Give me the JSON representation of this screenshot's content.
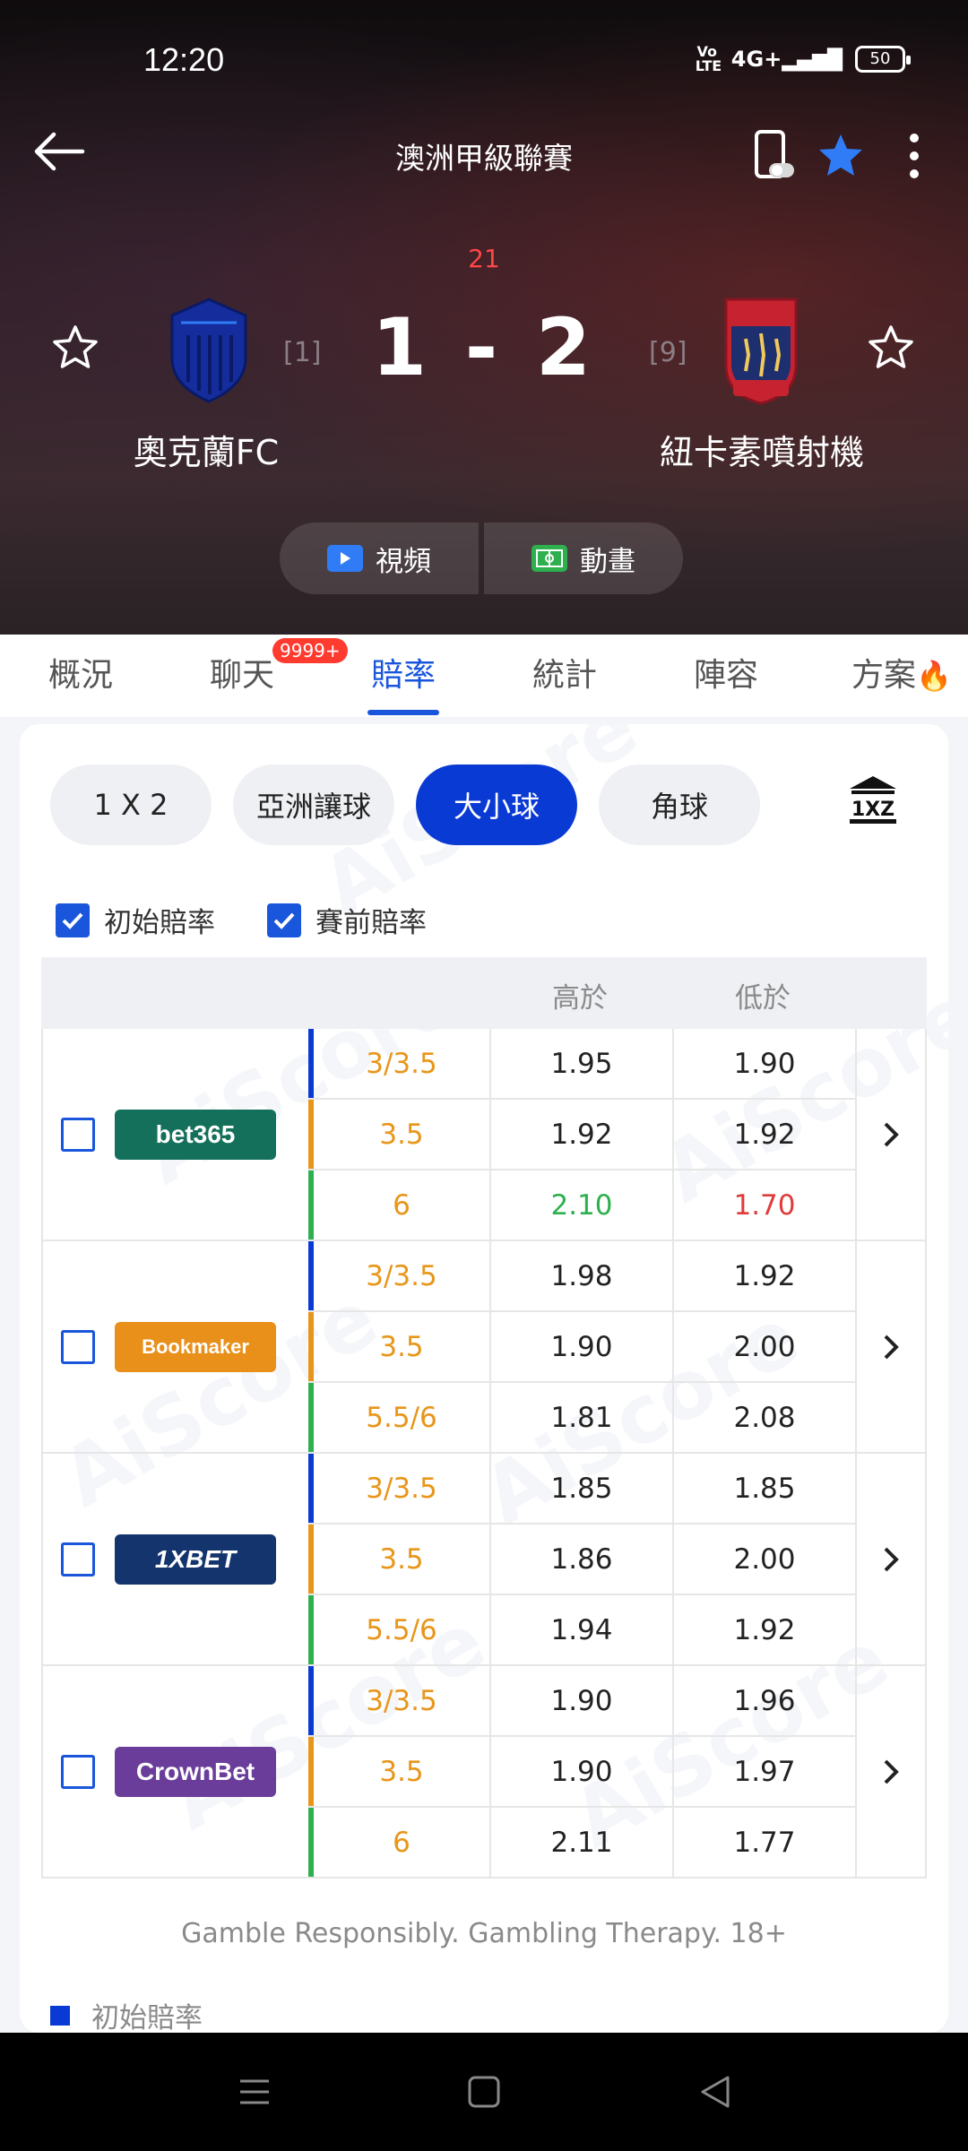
{
  "status": {
    "time": "12:20",
    "volte": "Vo LTE",
    "signal": "4G+",
    "battery": "50"
  },
  "header": {
    "league": "澳洲甲級聯賽",
    "minute": "21",
    "score": "1 - 2",
    "home": {
      "name": "奧克蘭FC",
      "rank": "[1]"
    },
    "away": {
      "name": "紐卡素噴射機",
      "rank": "[9]"
    },
    "video_label": "視頻",
    "animation_label": "動畫"
  },
  "tabs": [
    {
      "label": "概況"
    },
    {
      "label": "聊天",
      "badge": "9999+"
    },
    {
      "label": "賠率"
    },
    {
      "label": "統計"
    },
    {
      "label": "陣容"
    },
    {
      "label": "方案"
    }
  ],
  "filters": [
    "1 X 2",
    "亞洲讓球",
    "大小球",
    "角球"
  ],
  "checks": {
    "opening": "初始賠率",
    "pre_match": "賽前賠率"
  },
  "table": {
    "head_over": "高於",
    "head_under": "低於",
    "books": [
      {
        "name": "bet365",
        "rows": [
          {
            "line": "3/3.5",
            "over": "1.95",
            "under": "1.90"
          },
          {
            "line": "3.5",
            "over": "1.92",
            "under": "1.92"
          },
          {
            "line": "6",
            "over": "2.10",
            "under": "1.70"
          }
        ]
      },
      {
        "name": "Bookmaker",
        "rows": [
          {
            "line": "3/3.5",
            "over": "1.98",
            "under": "1.92"
          },
          {
            "line": "3.5",
            "over": "1.90",
            "under": "2.00"
          },
          {
            "line": "5.5/6",
            "over": "1.81",
            "under": "2.08"
          }
        ]
      },
      {
        "name": "1XBET",
        "rows": [
          {
            "line": "3/3.5",
            "over": "1.85",
            "under": "1.85"
          },
          {
            "line": "3.5",
            "over": "1.86",
            "under": "2.00"
          },
          {
            "line": "5.5/6",
            "over": "1.94",
            "under": "1.92"
          }
        ]
      },
      {
        "name": "CrownBet",
        "rows": [
          {
            "line": "3/3.5",
            "over": "1.90",
            "under": "1.96"
          },
          {
            "line": "3.5",
            "over": "1.90",
            "under": "1.97"
          },
          {
            "line": "6",
            "over": "2.11",
            "under": "1.77"
          }
        ]
      }
    ]
  },
  "watermark": "AiScore",
  "footer": {
    "gamble_note": "Gamble Responsibly. Gambling Therapy. 18+",
    "legend_opening": "初始賠率"
  },
  "colors": {
    "accent": "#1a56db",
    "active_pill": "#0a3ad4",
    "line_orange": "#e8961a",
    "rise": "#2db04d",
    "fall": "#e03a3a"
  }
}
